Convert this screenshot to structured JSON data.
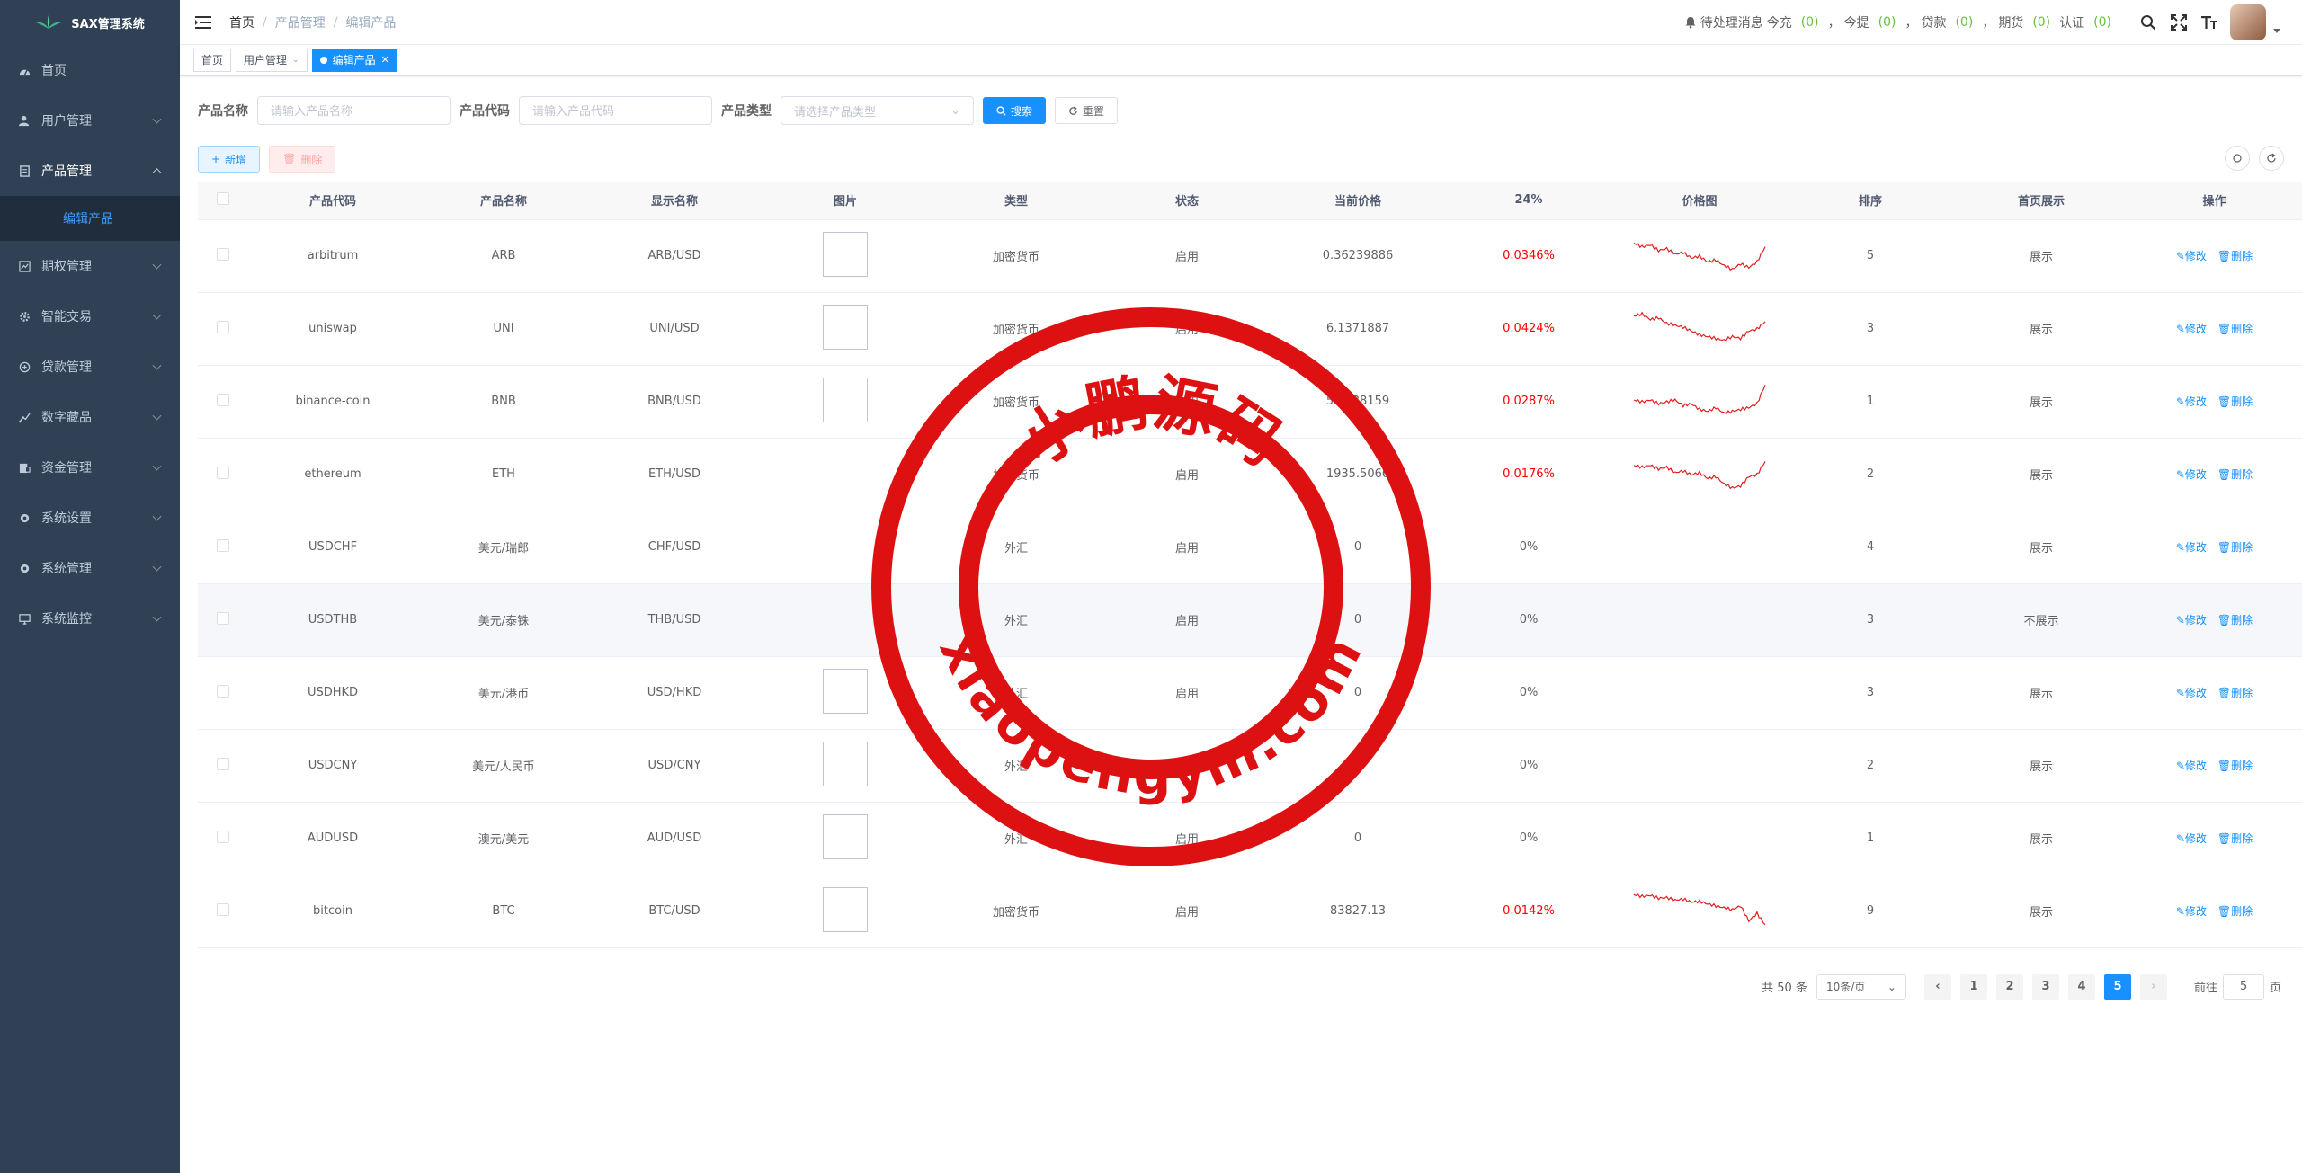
{
  "app": {
    "title": "SAX管理系统"
  },
  "sidebar": {
    "items": [
      {
        "label": "首页",
        "icon": "dashboard-icon"
      },
      {
        "label": "用户管理",
        "icon": "user-icon"
      },
      {
        "label": "产品管理",
        "icon": "document-icon"
      },
      {
        "label": "期权管理",
        "icon": "chart-icon"
      },
      {
        "label": "智能交易",
        "icon": "gear-icon"
      },
      {
        "label": "贷款管理",
        "icon": "loan-icon"
      },
      {
        "label": "数字藏品",
        "icon": "trend-icon"
      },
      {
        "label": "资金管理",
        "icon": "money-icon"
      },
      {
        "label": "系统设置",
        "icon": "settings-icon"
      },
      {
        "label": "系统管理",
        "icon": "settings-icon"
      },
      {
        "label": "系统监控",
        "icon": "monitor-icon"
      }
    ],
    "sub_item": "编辑产品"
  },
  "breadcrumb": {
    "home": "首页",
    "parent": "产品管理",
    "current": "编辑产品"
  },
  "header": {
    "notice_label": "待处理消息",
    "counters": [
      {
        "label": "今充",
        "value": "(0)"
      },
      {
        "label": "今提",
        "value": "(0)"
      },
      {
        "label": "贷款",
        "value": "(0)"
      },
      {
        "label": "期货",
        "value": "(0)"
      },
      {
        "label": "认证",
        "value": "(0)"
      }
    ],
    "comma": "，"
  },
  "tags": [
    {
      "label": "首页"
    },
    {
      "label": "用户管理"
    },
    {
      "label": "编辑产品"
    }
  ],
  "search": {
    "name_label": "产品名称",
    "name_placeholder": "请输入产品名称",
    "code_label": "产品代码",
    "code_placeholder": "请输入产品代码",
    "type_label": "产品类型",
    "type_placeholder": "请选择产品类型",
    "search_btn": "搜索",
    "reset_btn": "重置"
  },
  "toolbar": {
    "add_btn": "新增",
    "delete_btn": "删除"
  },
  "table": {
    "headers": [
      "产品代码",
      "产品名称",
      "显示名称",
      "图片",
      "类型",
      "状态",
      "当前价格",
      "24%",
      "价格图",
      "排序",
      "首页展示",
      "操作"
    ],
    "edit_label": "修改",
    "delete_label": "删除",
    "rows": [
      {
        "code": "arbitrum",
        "name": "ARB",
        "display": "ARB/USD",
        "img": true,
        "type": "加密货币",
        "status": "启用",
        "price": "0.36239886",
        "change": "0.0346%",
        "red": true,
        "spark": [
          0.2,
          0.3,
          0.25,
          0.4,
          0.35,
          0.5,
          0.45,
          0.6,
          0.55,
          0.7,
          0.65,
          0.8,
          0.9,
          0.75,
          0.85,
          0.7,
          0.3
        ]
      },
      {
        "code": "uniswap",
        "name": "UNI",
        "display": "UNI/USD",
        "img": true,
        "type": "加密货币",
        "status": "启用",
        "price": "6.1371887",
        "change": "0.0424%",
        "red": true,
        "spark": [
          0.2,
          0.15,
          0.3,
          0.25,
          0.4,
          0.45,
          0.5,
          0.6,
          0.7,
          0.75,
          0.8,
          0.85,
          0.75,
          0.8,
          0.6,
          0.55,
          0.35
        ]
      },
      {
        "code": "binance-coin",
        "name": "BNB",
        "display": "BNB/USD",
        "img": true,
        "type": "加密货币",
        "status": "启用",
        "price": "596.38159",
        "change": "0.0287%",
        "red": true,
        "spark": [
          0.5,
          0.55,
          0.5,
          0.6,
          0.55,
          0.5,
          0.65,
          0.6,
          0.75,
          0.8,
          0.7,
          0.85,
          0.8,
          0.75,
          0.7,
          0.6,
          0.1
        ]
      },
      {
        "code": "ethereum",
        "name": "ETH",
        "display": "ETH/USD",
        "img": false,
        "type": "加密货币",
        "status": "启用",
        "price": "1935.5066",
        "change": "0.0176%",
        "red": true,
        "spark": [
          0.3,
          0.35,
          0.3,
          0.4,
          0.35,
          0.5,
          0.45,
          0.55,
          0.5,
          0.65,
          0.6,
          0.8,
          0.9,
          0.85,
          0.6,
          0.55,
          0.2
        ]
      },
      {
        "code": "USDCHF",
        "name": "美元/瑞郎",
        "display": "CHF/USD",
        "img": false,
        "type": "外汇",
        "status": "启用",
        "price": "0",
        "change": "0%",
        "red": false,
        "spark": []
      },
      {
        "code": "USDTHB",
        "name": "美元/泰铢",
        "display": "THB/USD",
        "img": false,
        "type": "外汇",
        "status": "启用",
        "price": "0",
        "change": "0%",
        "red": false,
        "spark": [],
        "home": "不展示"
      },
      {
        "code": "USDHKD",
        "name": "美元/港币",
        "display": "USD/HKD",
        "img": true,
        "type": "外汇",
        "status": "启用",
        "price": "0",
        "change": "0%",
        "red": false,
        "spark": []
      },
      {
        "code": "USDCNY",
        "name": "美元/人民币",
        "display": "USD/CNY",
        "img": true,
        "type": "外汇",
        "status": "启用",
        "price": "0",
        "change": "0%",
        "red": false,
        "spark": []
      },
      {
        "code": "AUDUSD",
        "name": "澳元/美元",
        "display": "AUD/USD",
        "img": true,
        "type": "外汇",
        "status": "启用",
        "price": "0",
        "change": "0%",
        "red": false,
        "spark": []
      },
      {
        "code": "bitcoin",
        "name": "BTC",
        "display": "BTC/USD",
        "img": true,
        "type": "加密货币",
        "status": "启用",
        "price": "83827.13",
        "change": "0.0142%",
        "red": true,
        "spark": [
          0.1,
          0.15,
          0.12,
          0.2,
          0.18,
          0.25,
          0.22,
          0.3,
          0.28,
          0.35,
          0.4,
          0.45,
          0.5,
          0.4,
          0.8,
          0.6,
          0.9
        ]
      }
    ],
    "sorts": [
      "5",
      "3",
      "1",
      "2",
      "4",
      "3",
      "3",
      "2",
      "1",
      "9"
    ],
    "home_default": "展示"
  },
  "pagination": {
    "total": "共 50 条",
    "page_size": "10条/页",
    "pages": [
      "1",
      "2",
      "3",
      "4",
      "5"
    ],
    "current": "5",
    "goto_label": "前往",
    "goto_value": "5",
    "page_unit": "页"
  },
  "watermark": {
    "top_text": "小鹏源码",
    "bottom_text": "xiaopengym.com"
  },
  "colors": {
    "sidebar_bg": "#304156",
    "primary": "#1890ff",
    "danger": "#ff0000",
    "stamp": "#dd1111",
    "success": "#67c23a"
  }
}
